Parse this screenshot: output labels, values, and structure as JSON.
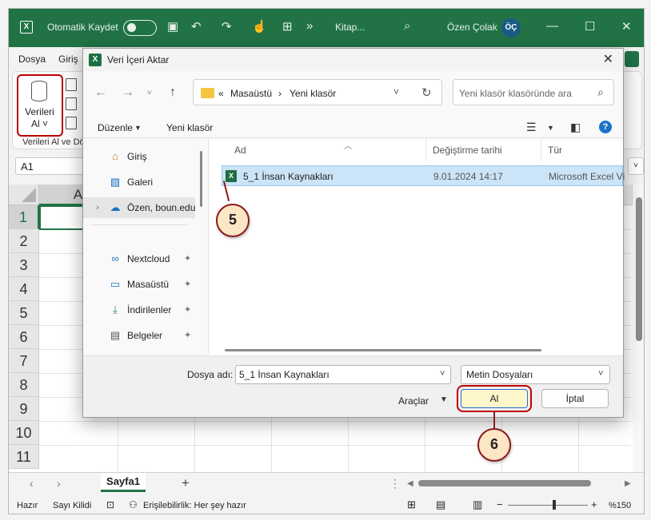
{
  "titlebar": {
    "autosave_label": "Otomatik Kaydet",
    "file_title": "Kitap...",
    "user_name": "Özen Çolak",
    "user_initials": "ÖÇ"
  },
  "menubar": {
    "items": [
      "Dosya",
      "Giriş"
    ]
  },
  "ribbon": {
    "get_data_label": "Verileri Al",
    "get_data_line1": "Verileri",
    "get_data_line2": "Al ˅",
    "group_label": "Verileri Al ve Dö"
  },
  "formula_bar": {
    "name_box": "A1"
  },
  "grid": {
    "column_headers": [
      "A"
    ],
    "row_headers": [
      "1",
      "2",
      "3",
      "4",
      "5",
      "6",
      "7",
      "8",
      "9",
      "10",
      "11"
    ]
  },
  "sheets": {
    "tabs": [
      "Sayfa1"
    ],
    "add_label": "+"
  },
  "statusbar": {
    "ready": "Hazır",
    "scroll_lock": "Sayı Kilidi",
    "accessibility": "Erişilebilirlik: Her şey hazır",
    "zoom": "%150"
  },
  "dialog": {
    "title": "Veri İçeri Aktar",
    "breadcrumb": [
      "«",
      "Masaüstü",
      "›",
      "Yeni klasör"
    ],
    "search_placeholder": "Yeni klasör klasöründe ara",
    "commands": {
      "organize": "Düzenle",
      "new_folder": "Yeni klasör"
    },
    "nav_items": [
      {
        "label": "Giriş",
        "icon": "home-icon"
      },
      {
        "label": "Galeri",
        "icon": "gallery-icon"
      },
      {
        "label": "Özen, boun.edu",
        "icon": "onedrive-icon"
      },
      {
        "label": "Nextcloud",
        "icon": "nextcloud-icon"
      },
      {
        "label": "Masaüstü",
        "icon": "desktop-icon"
      },
      {
        "label": "İndirilenler",
        "icon": "download-icon"
      },
      {
        "label": "Belgeler",
        "icon": "documents-icon"
      }
    ],
    "columns": {
      "name": "Ad",
      "modified": "Değiştirme tarihi",
      "type": "Tür"
    },
    "files": [
      {
        "name": "5_1 İnsan Kaynakları",
        "modified": "9.01.2024 14:17",
        "type": "Microsoft Excel Vi"
      }
    ],
    "filename_label": "Dosya adı:",
    "filename_value": "5_1 İnsan Kaynakları",
    "filetype_value": "Metin Dosyaları",
    "tools_label": "Araçlar",
    "ok_label": "Al",
    "cancel_label": "İptal"
  },
  "callouts": {
    "step5": "5",
    "step6": "6"
  },
  "colors": {
    "excel_green": "#217346",
    "highlight_red": "#c00000",
    "selection_blue": "#cce4f7"
  }
}
